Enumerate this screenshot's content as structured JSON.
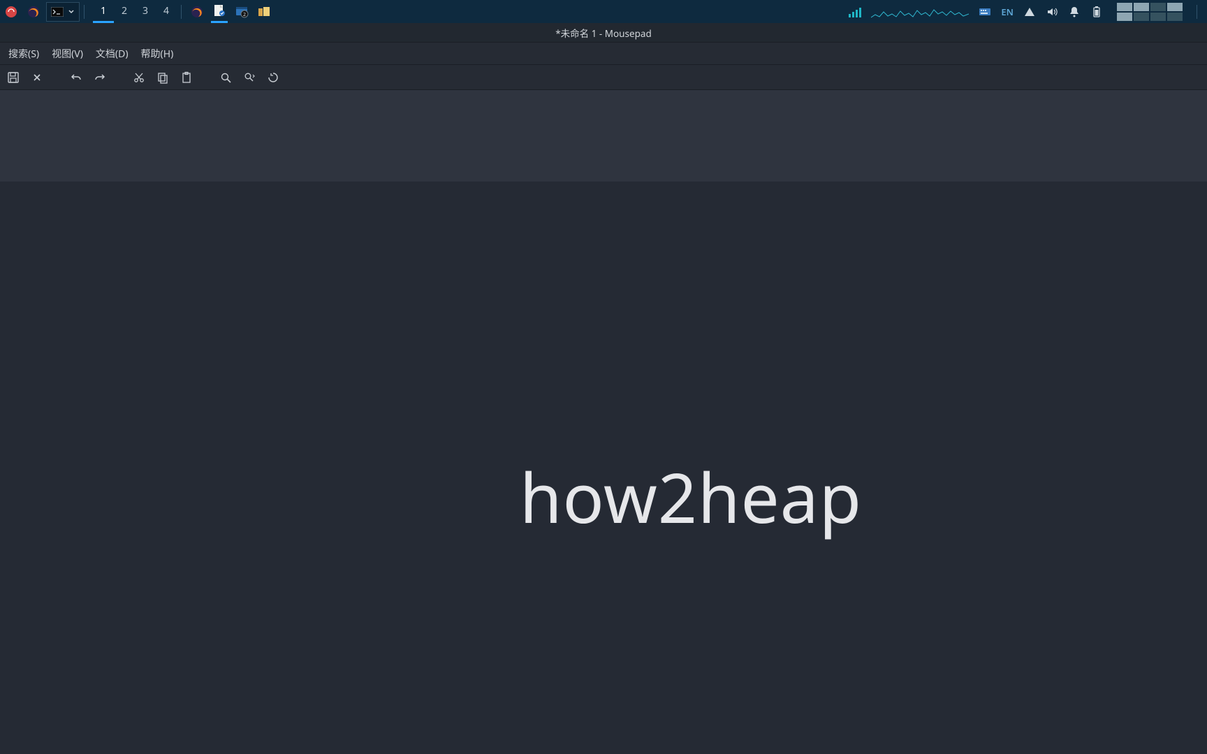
{
  "taskbar": {
    "workspaces": [
      "1",
      "2",
      "3",
      "4"
    ],
    "active_workspace": 0,
    "language": "EN"
  },
  "window": {
    "title": "*未命名 1 - Mousepad"
  },
  "menubar": {
    "items": [
      "搜索(S)",
      "视图(V)",
      "文档(D)",
      "帮助(H)"
    ]
  },
  "content": {
    "headline": "how2heap"
  }
}
